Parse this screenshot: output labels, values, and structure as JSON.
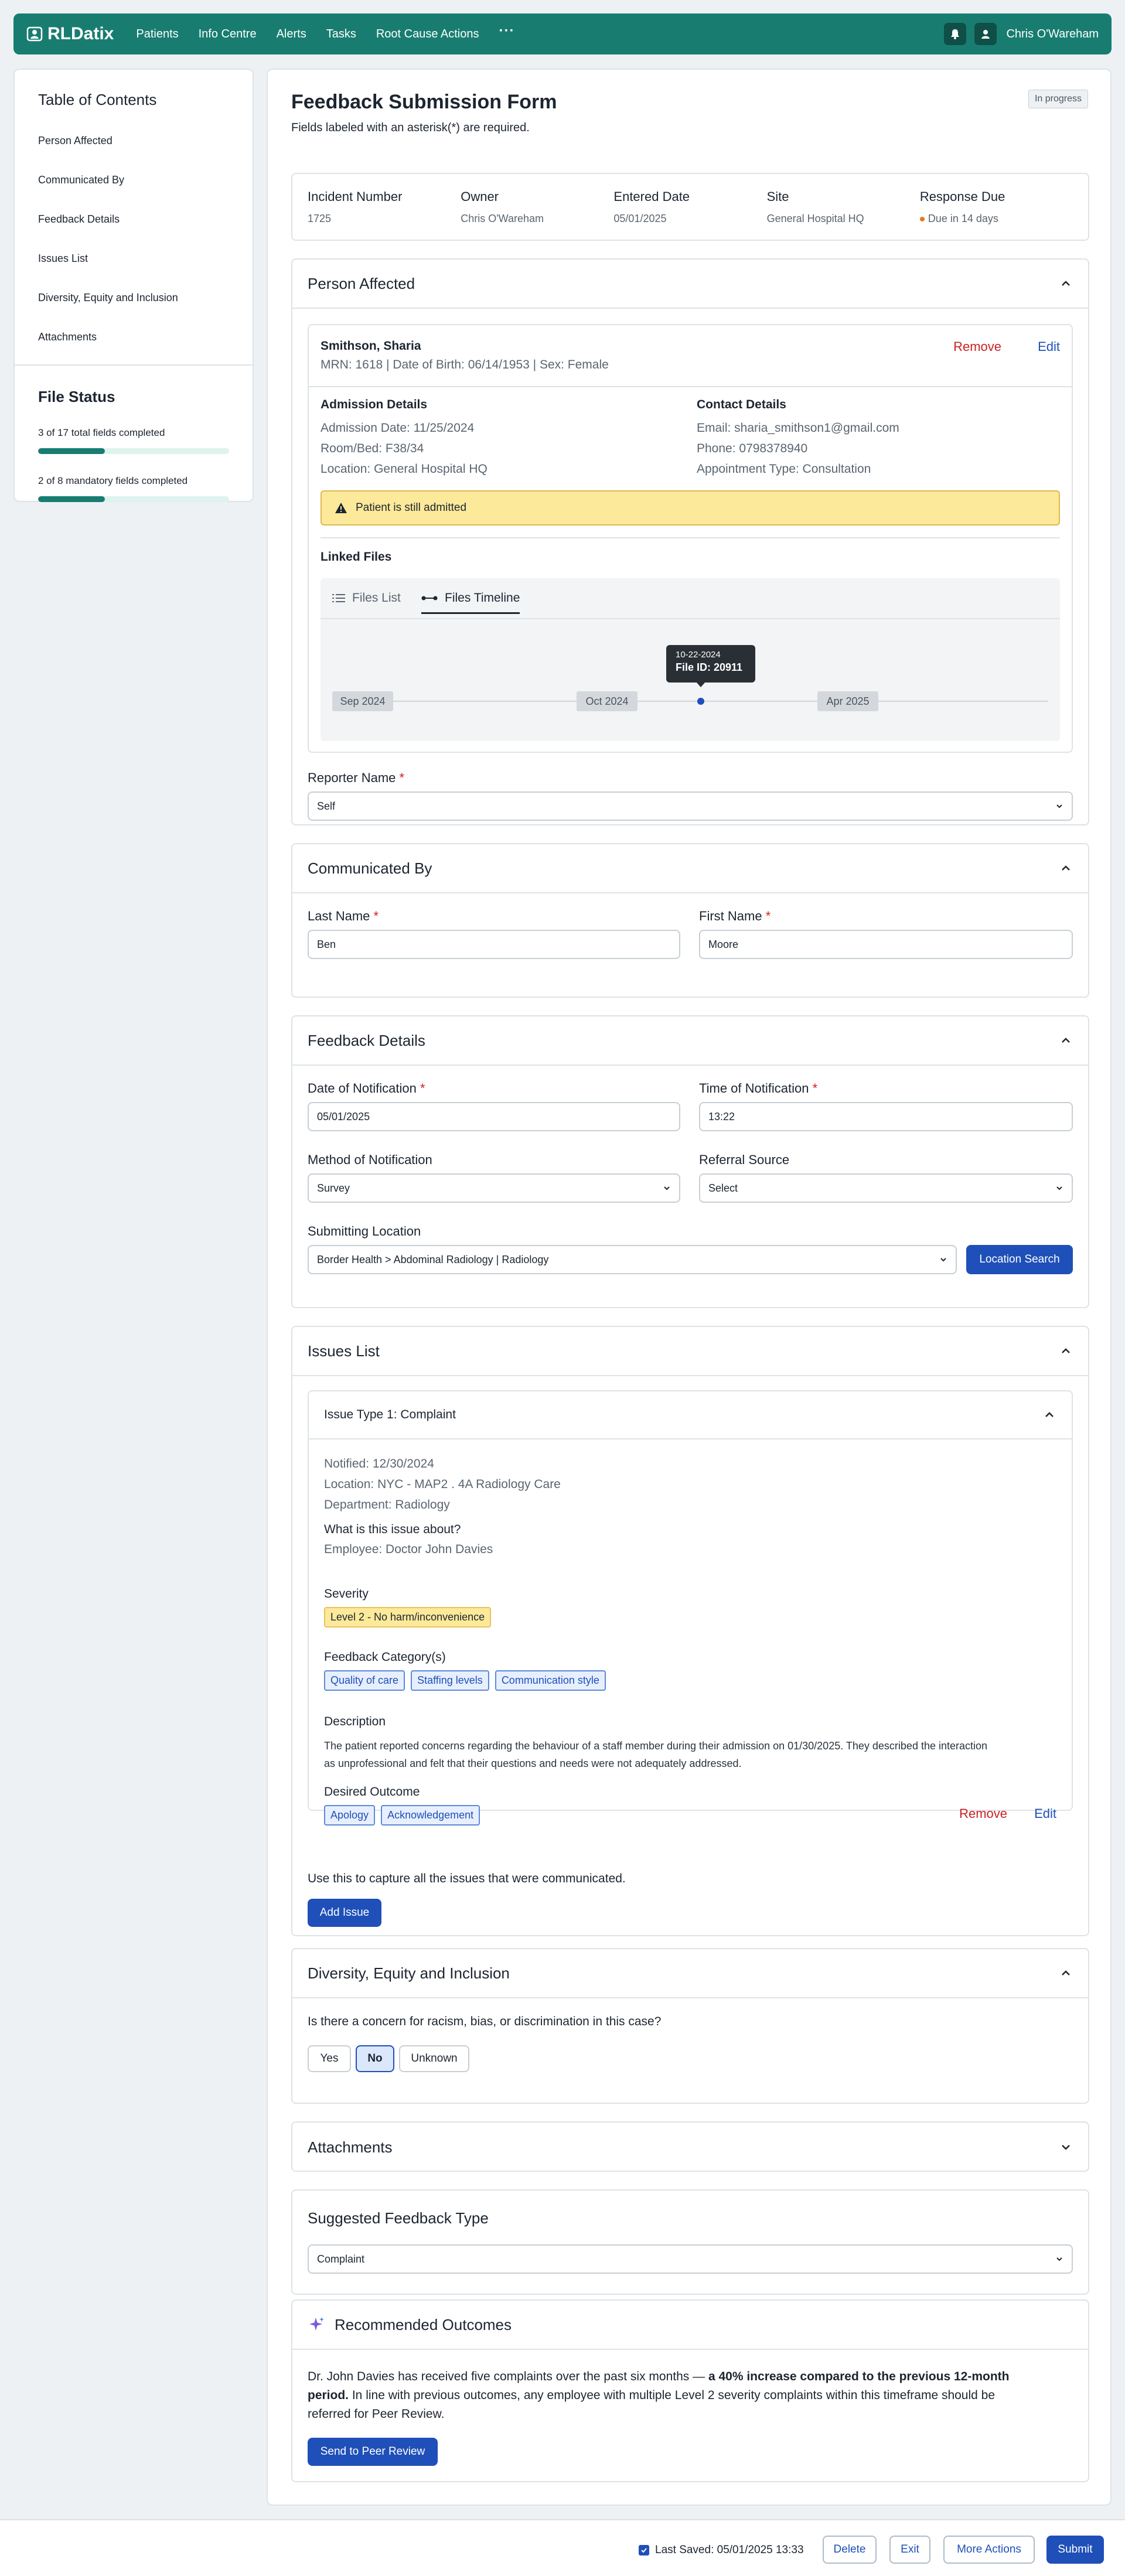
{
  "app": {
    "name": "RLDatix"
  },
  "nav": {
    "items": [
      "Patients",
      "Info Centre",
      "Alerts",
      "Tasks",
      "Root Cause Actions"
    ],
    "more": "···"
  },
  "user": {
    "name": "Chris O'Wareham"
  },
  "toc": {
    "title": "Table of Contents",
    "items": [
      "Person Affected",
      "Communicated By",
      "Feedback Details",
      "Issues List",
      "Diversity, Equity and Inclusion",
      "Attachments"
    ]
  },
  "file_status": {
    "title": "File Status",
    "total": {
      "text": "3 of 17 total fields completed",
      "progress": 0.35
    },
    "mandatory": {
      "text": "2 of 8 mandatory fields completed",
      "progress": 0.35
    }
  },
  "form": {
    "title": "Feedback Submission Form",
    "subtitle": "Fields labeled with an asterisk(*) are required.",
    "status": "In progress"
  },
  "summary": {
    "incident_label": "Incident Number",
    "incident_value": "1725",
    "owner_label": "Owner",
    "owner_value": "Chris O'Wareham",
    "entered_label": "Entered Date",
    "entered_value": "05/01/2025",
    "site_label": "Site",
    "site_value": "General Hospital HQ",
    "due_label": "Response Due",
    "due_value": "Due in 14 days"
  },
  "person": {
    "section_title": "Person Affected",
    "name": "Smithson, Sharia",
    "details": "MRN: 1618 | Date of Birth: 06/14/1953  | Sex: Female",
    "remove": "Remove",
    "edit": "Edit",
    "admission_title": "Admission Details",
    "admission_lines": [
      "Admission Date: 11/25/2024",
      "Room/Bed: F38/34",
      "Location: General Hospital HQ"
    ],
    "contact_title": "Contact Details",
    "contact_lines": [
      "Email: sharia_smithson1@gmail.com",
      "Phone: 0798378940",
      "Appointment Type: Consultation"
    ],
    "warning": "Patient is still admitted",
    "linked_title": "Linked Files",
    "tab_list": "Files List",
    "tab_timeline": "Files Timeline",
    "timeline": {
      "labels": [
        "Sep 2024",
        "Oct 2024",
        "Apr 2025"
      ],
      "tooltip_date": "10-22-2024",
      "tooltip_file": "File ID: 20911"
    },
    "reporter_label": "Reporter Name",
    "reporter_value": "Self"
  },
  "communicated": {
    "section_title": "Communicated By",
    "last_label": "Last Name",
    "last_value": "Ben",
    "first_label": "First Name",
    "first_value": "Moore"
  },
  "feedback": {
    "section_title": "Feedback Details",
    "date_label": "Date of Notification",
    "date_value": "05/01/2025",
    "time_label": "Time of Notification",
    "time_value": "13:22",
    "method_label": "Method of Notification",
    "method_value": "Survey",
    "referral_label": "Referral Source",
    "referral_value": "Select",
    "location_label": "Submitting Location",
    "location_value": "Border Health > Abdominal Radiology | Radiology",
    "location_button": "Location Search"
  },
  "issues": {
    "section_title": "Issues List",
    "issue_title": "Issue Type 1: Complaint",
    "notified": "Notified: 12/30/2024",
    "location": "Location: NYC - MAP2 . 4A Radiology Care",
    "department": "Department: Radiology",
    "about_label": "What is this issue about?",
    "about_value": "Employee: Doctor John Davies",
    "severity_label": "Severity",
    "severity_value": "Level 2 - No harm/inconvenience",
    "category_label": "Feedback Category(s)",
    "categories": [
      "Quality of care",
      "Staffing levels",
      "Communication style"
    ],
    "desc_label": "Description",
    "desc_line1": "The patient reported concerns regarding the behaviour of a staff member during their admission on 01/30/2025. They described the interaction",
    "desc_line2": "as unprofessional and felt that their questions and needs were not adequately addressed.",
    "outcome_label": "Desired Outcome",
    "outcomes": [
      "Apology",
      "Acknowledgement"
    ],
    "remove": "Remove",
    "edit": "Edit",
    "hint": "Use this to capture all the issues that were communicated.",
    "add_button": "Add Issue"
  },
  "dei": {
    "section_title": "Diversity, Equity and Inclusion",
    "question": "Is there a concern for racism, bias, or discrimination in this case?",
    "options": [
      "Yes",
      "No",
      "Unknown"
    ],
    "selected": "No"
  },
  "attachments": {
    "section_title": "Attachments"
  },
  "suggested": {
    "section_title": "Suggested Feedback Type",
    "value": "Complaint"
  },
  "recommended": {
    "section_title": "Recommended Outcomes",
    "text_part1": "Dr. John Davies has received five complaints over the past six months — ",
    "text_bold1": "a 40% increase compared to the previous 12-month",
    "text_bold2": "period.",
    "text_part2": " In line with previous outcomes, any employee with multiple Level 2 severity complaints within this timeframe should be",
    "text_part3": "referred for Peer Review.",
    "button": "Send to Peer Review"
  },
  "footer": {
    "last_saved": "Last Saved: 05/01/2025 13:33",
    "delete": "Delete",
    "exit": "Exit",
    "more": "More Actions",
    "submit": "Submit"
  }
}
